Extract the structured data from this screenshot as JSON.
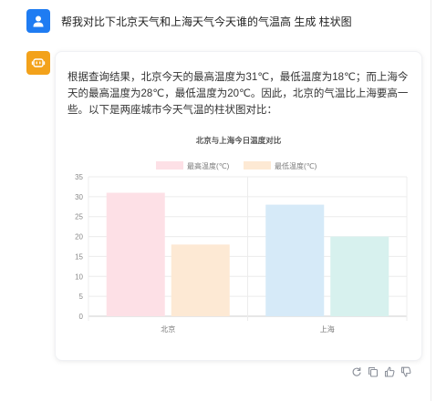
{
  "conversation": {
    "question": "帮我对比下北京天气和上海天气今天谁的气温高 生成 柱状图",
    "answer": "根据查询结果，北京今天的最高温度为31℃，最低温度为18℃；而上海今天的最高温度为28℃，最低温度为20℃。因此，北京的气温比上海要高一些。以下是两座城市今天气温的柱状图对比："
  },
  "actions": {
    "icons": [
      "refresh-icon",
      "copy-icon",
      "thumbs-up-icon",
      "thumbs-down-icon"
    ]
  },
  "colors": {
    "user_avatar": "#1f7cf2",
    "bot_avatar": "#f3a21b",
    "max_fill": "#fde0e6",
    "max_stroke": "#f6b3c2",
    "min_fill": "#fde9d4",
    "min_stroke": "#f9c999",
    "max_fill_2": "#d6eaf8",
    "min_fill_2": "#d7f1ee"
  },
  "chart_data": {
    "type": "bar",
    "title": "北京与上海今日温度对比",
    "categories": [
      "北京",
      "上海"
    ],
    "series": [
      {
        "name": "最高温度(℃)",
        "values": [
          31,
          28
        ]
      },
      {
        "name": "最低温度(℃)",
        "values": [
          18,
          20
        ]
      }
    ],
    "ylim": [
      0,
      35
    ],
    "yticks": [
      0,
      5,
      10,
      15,
      20,
      25,
      30,
      35
    ],
    "grid": true,
    "legend": "top"
  }
}
